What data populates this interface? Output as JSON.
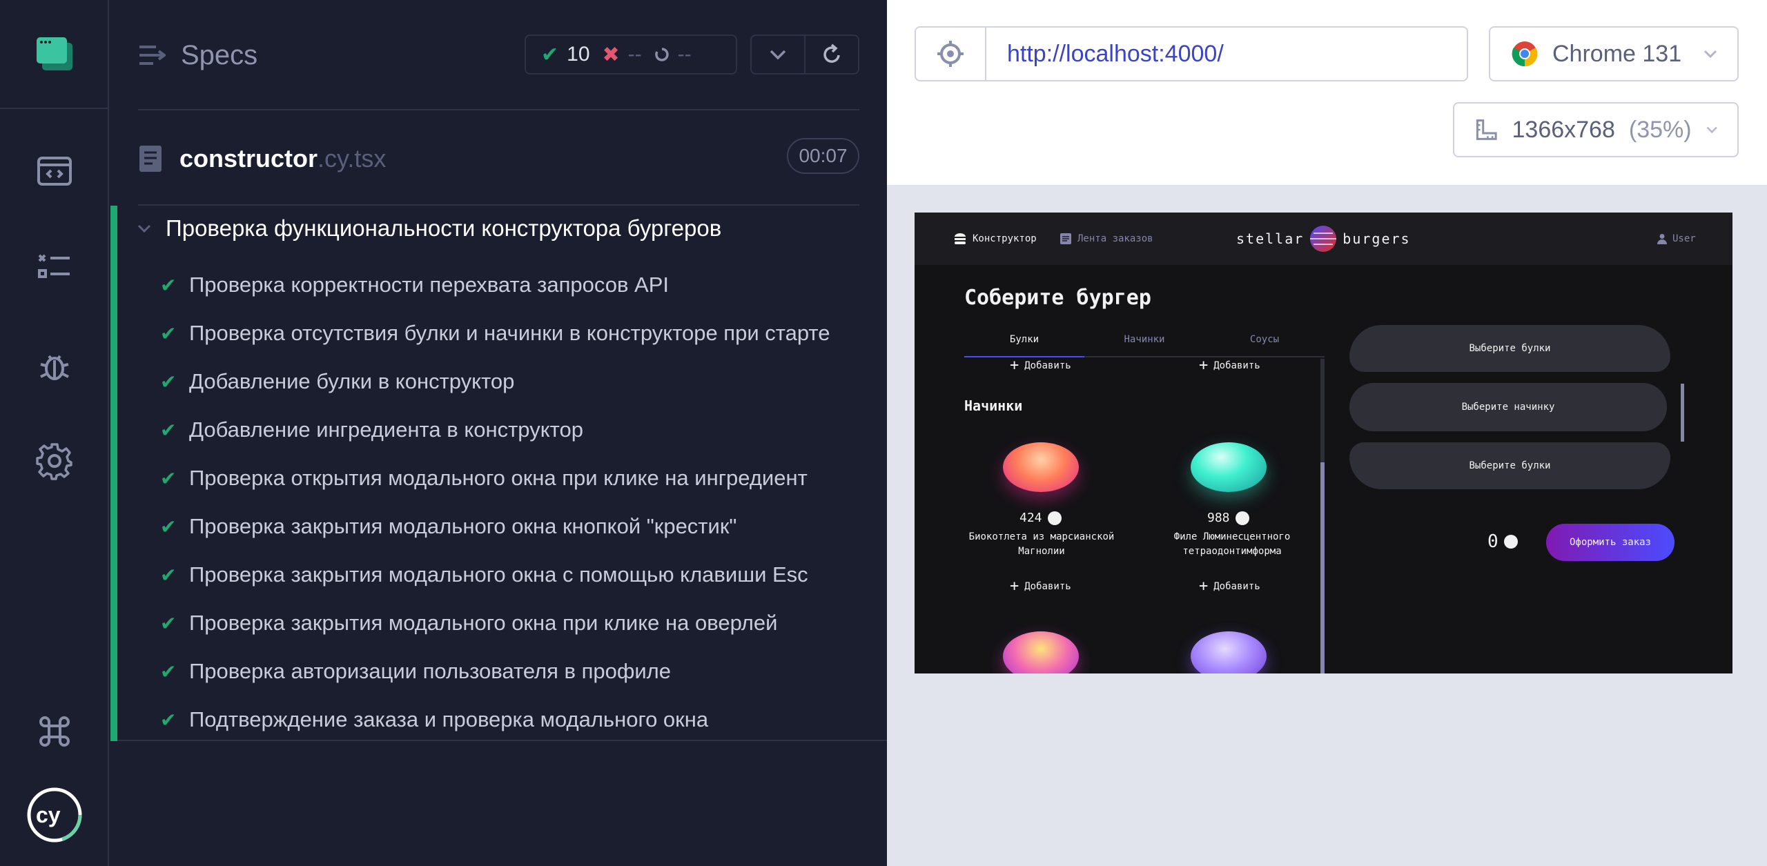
{
  "nav": {
    "items": [
      "specs-icon",
      "runs-icon",
      "debug-icon",
      "settings-icon"
    ],
    "shortcuts_icon": "command-icon",
    "logo": "cy"
  },
  "reporter": {
    "specs_label": "Specs",
    "stats": {
      "passed": "10",
      "failed": "--",
      "pending": "--"
    },
    "file": {
      "name": "constructor",
      "ext": ".cy.tsx",
      "duration": "00:07"
    },
    "suite_title": "Проверка функциональности конструктора бургеров",
    "tests": [
      "Проверка корректности перехвата запросов API",
      "Проверка отсутствия булки и начинки в конструкторе при старте",
      "Добавление булки в конструктор",
      "Добавление ингредиента в конструктор",
      "Проверка открытия модального окна при клике на ингредиент",
      "Проверка закрытия модального окна кнопкой \"крестик\"",
      "Проверка закрытия модального окна с помощью клавиши Esc",
      "Проверка закрытия модального окна при клике на оверлей",
      "Проверка авторизации пользователя в профиле",
      "Подтверждение заказа и проверка модального окна"
    ]
  },
  "aut": {
    "url": "http://localhost:4000/",
    "browser": "Chrome 131",
    "viewport": "1366x768",
    "viewport_scale": "(35%)"
  },
  "app": {
    "nav_constructor": "Конструктор",
    "nav_feed": "Лента заказов",
    "logo_left": "stellar",
    "logo_right": "burgers",
    "nav_profile": "User",
    "heading": "Соберите бургер",
    "tabs": [
      "Булки",
      "Начинки",
      "Соусы"
    ],
    "add_label": "Добавить",
    "section_fillings": "Начинки",
    "ingredients": [
      {
        "price": "424",
        "name": "Биокотлета из марсианской Магнолии"
      },
      {
        "price": "988",
        "name": "Филе Люминесцентного тетраодонтимформа"
      }
    ],
    "slot_top": "Выберите булки",
    "slot_mid": "Выберите начинку",
    "slot_bottom": "Выберите булки",
    "total": "0",
    "order_button": "Оформить заказ"
  },
  "colors": {
    "accent_green": "#1fa971",
    "fail_red": "#e45770",
    "app_accent": "#4c4cff"
  }
}
